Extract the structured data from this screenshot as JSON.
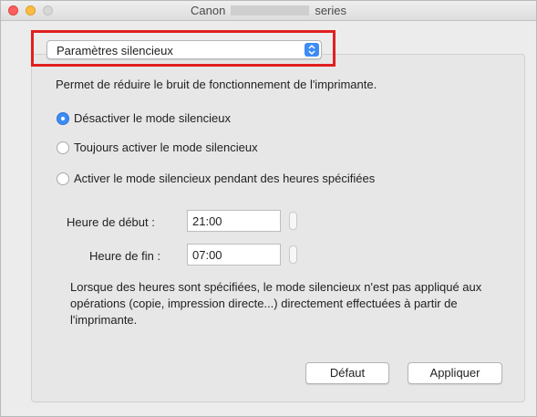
{
  "window": {
    "title_prefix": "Canon",
    "title_suffix": "series"
  },
  "popup": {
    "selected": "Paramètres silencieux"
  },
  "description": "Permet de réduire le bruit de fonctionnement de l'imprimante.",
  "options": [
    {
      "label": "Désactiver le mode silencieux",
      "selected": true
    },
    {
      "label": "Toujours activer le mode silencieux",
      "selected": false
    },
    {
      "label": "Activer le mode silencieux pendant des heures spécifiées",
      "selected": false
    }
  ],
  "start_time": {
    "label": "Heure de début :",
    "value": "21:00"
  },
  "end_time": {
    "label": "Heure de fin :",
    "value": "07:00"
  },
  "note": "Lorsque des heures sont spécifiées, le mode silencieux n'est pas appliqué aux opérations (copie, impression directe...) directement effectuées à partir de l'imprimante.",
  "buttons": {
    "default": "Défaut",
    "apply": "Appliquer"
  },
  "colors": {
    "accent": "#3d8cf5",
    "highlight": "#e02020"
  }
}
